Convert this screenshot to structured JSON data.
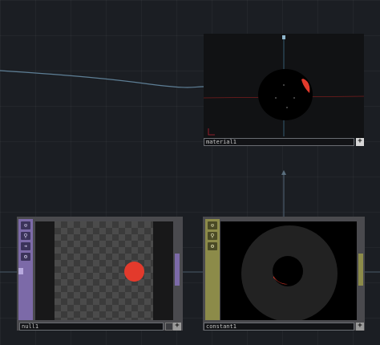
{
  "nodes": {
    "material": {
      "name": "material1",
      "plus_label": "+"
    },
    "null": {
      "name": "null1",
      "plus_label": "+",
      "side_icons": [
        "⊙",
        "⚲",
        "➔",
        "⚙"
      ]
    },
    "constant": {
      "name": "constant1",
      "plus_label": "+",
      "side_icons": [
        "⊙",
        "⚲",
        "⚙"
      ]
    }
  },
  "colors": {
    "background": "#1b1e23",
    "null_accent": "#7c6aa8",
    "constant_accent": "#8c8b49",
    "red_shape": "#e33a2c",
    "wire": "#6b8fa8"
  }
}
